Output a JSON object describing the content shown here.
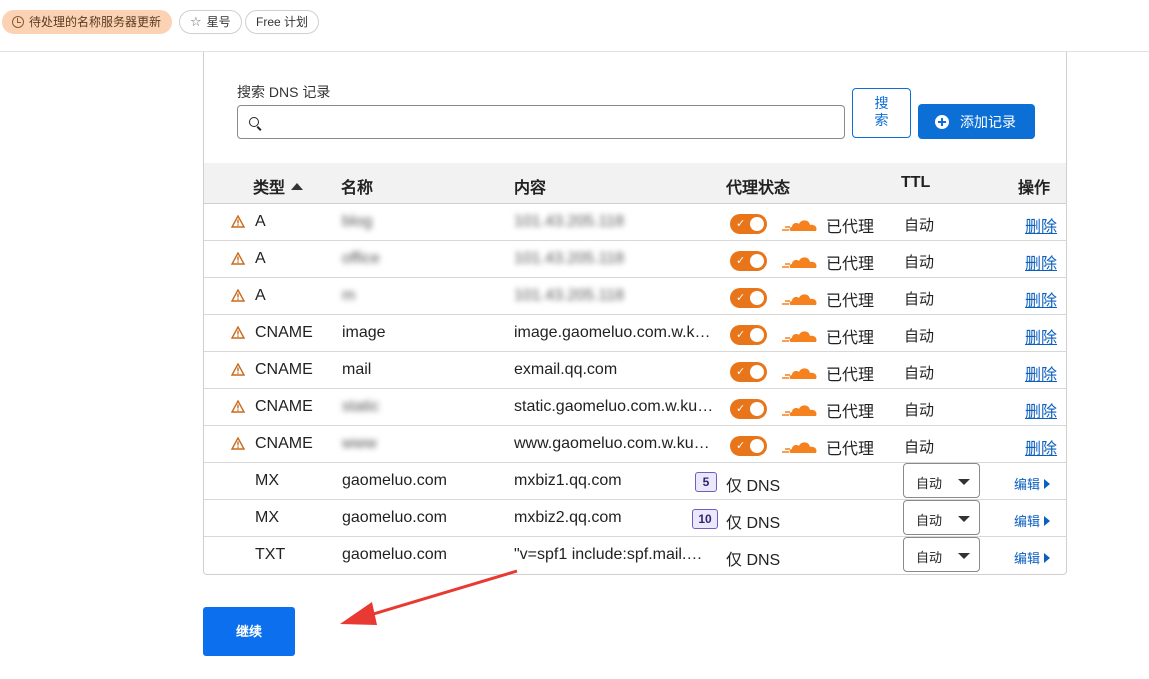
{
  "topbar": {
    "pending_label": "待处理的名称服务器更新",
    "star_label": "星号",
    "plan_label": "Free 计划"
  },
  "search": {
    "label": "搜索 DNS 记录",
    "value": "",
    "placeholder": "",
    "search_button": "搜索",
    "add_button": "添加记录"
  },
  "table": {
    "headers": {
      "type": "类型",
      "name": "名称",
      "content": "内容",
      "proxy": "代理状态",
      "ttl": "TTL",
      "ops": "操作"
    },
    "rows": [
      {
        "type": "A",
        "name": "blog",
        "content": "101.43.205.118",
        "proxy": "已代理",
        "ttl": "自动",
        "action": "删除"
      },
      {
        "type": "A",
        "name": "office",
        "content": "101.43.205.118",
        "proxy": "已代理",
        "ttl": "自动",
        "action": "删除"
      },
      {
        "type": "A",
        "name": "m",
        "content": "101.43.205.118",
        "proxy": "已代理",
        "ttl": "自动",
        "action": "删除"
      },
      {
        "type": "CNAME",
        "name": "image",
        "content": "image.gaomeluo.com.w.k…",
        "proxy": "已代理",
        "ttl": "自动",
        "action": "删除"
      },
      {
        "type": "CNAME",
        "name": "mail",
        "content": "exmail.qq.com",
        "proxy": "已代理",
        "ttl": "自动",
        "action": "删除"
      },
      {
        "type": "CNAME",
        "name": "static",
        "content": "static.gaomeluo.com.w.kunl…",
        "proxy": "已代理",
        "ttl": "自动",
        "action": "删除"
      },
      {
        "type": "CNAME",
        "name": "www",
        "content": "www.gaomeluo.com.w.ku…",
        "proxy": "已代理",
        "ttl": "自动",
        "action": "删除"
      },
      {
        "type": "MX",
        "name": "gaomeluo.com",
        "content": "mxbiz1.qq.com",
        "priority": "5",
        "proxy": "仅 DNS",
        "ttl": "自动",
        "action": "编辑"
      },
      {
        "type": "MX",
        "name": "gaomeluo.com",
        "content": "mxbiz2.qq.com",
        "priority": "10",
        "proxy": "仅 DNS",
        "ttl": "自动",
        "action": "编辑"
      },
      {
        "type": "TXT",
        "name": "gaomeluo.com",
        "content": "\"v=spf1 include:spf.mail.…",
        "proxy": "仅 DNS",
        "ttl": "自动",
        "action": "编辑"
      }
    ]
  },
  "continue_button": "继续",
  "colors": {
    "accent": "#0b6fd6",
    "proxy_orange": "#e8751a",
    "warning": "#c96a1b"
  }
}
